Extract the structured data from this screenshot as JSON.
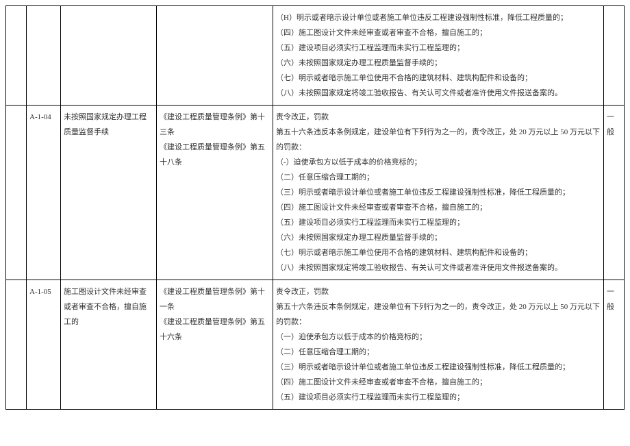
{
  "rows": [
    {
      "code": "",
      "item": "",
      "basis": "",
      "content": [
        "（H）明示或者暗示设计单位或者施工单位违反工程建设强制性标准，降低工程质量的；",
        "（四）施工图设计文件未经审查或者审查不合格，擅自施工的；",
        "（五）建设项目必须实行工程监理而未实行工程监理的；",
        "（六）未按照国家规定办理工程质量监督手续的；",
        "（七）明示或者暗示施工单位使用不合格的建筑材料、建筑构配件和设备的；",
        "（八）未按照国家规定将竣工验收报告、有关认可文件或者准许使用文件报送备案的。"
      ],
      "level": ""
    },
    {
      "code": "A-1-04",
      "item": "未按照国家规定办理工程质量监督手续",
      "basis": "《建设工程质量管理条例》第十三条\n《建设工程质量管理条例》第五十八条",
      "content": [
        "责令改正，罚款",
        "第五十六条违反本条例规定，建设单位有下列行为之一的，责令改正，处 20 万元以上 50 万元以下的罚款：",
        "（-）迫使承包方以低于成本的价格竞标的；",
        "（二）任意压缩合理工期的；",
        "（三）明示或者暗示设计单位或者施工单位违反工程建设强制性标准，降低工程质量的；",
        "（四）施工图设计文件未经审查或者审查不合格，擅自施工的；",
        "（五）建设项目必须实行工程监理而未实行工程监理的；",
        "（六）未按照国家规定办理工程质量监督手续的；",
        "（七）明示或者暗示施工单位使用不合格的建筑材料、建筑构配件和设备的；",
        "（八）未按照国家规定将竣工验收报告、有关认可文件或者准许使用文件报送备案的。"
      ],
      "level": "一般"
    },
    {
      "code": "A-1-05",
      "item": "施工图设计文件未经审查或者审查不合格，擅自施工的",
      "basis": "《建设工程质量管理条例》第十一条\n《建设工程质量管理条例》第五十六条",
      "content": [
        "责令改正，罚款",
        "第五十六条违反本条例规定，建设单位有下列行为之一的，责令改正，处 20 万元以上 50 万元以下的罚款：",
        "（一）迫使承包方以低于成本的价格竞标的；",
        "（二）任意压缩合理工期的；",
        "（三）明示或者暗示设计单位或者施工单位违反工程建设强制性标准，降低工程质量的；",
        "（四）施工图设计文件未经审查或者审查不合格，擅自施工的；",
        "（五）建设项目必须实行工程监理而未实行工程监理的；"
      ],
      "level": "一般"
    }
  ]
}
